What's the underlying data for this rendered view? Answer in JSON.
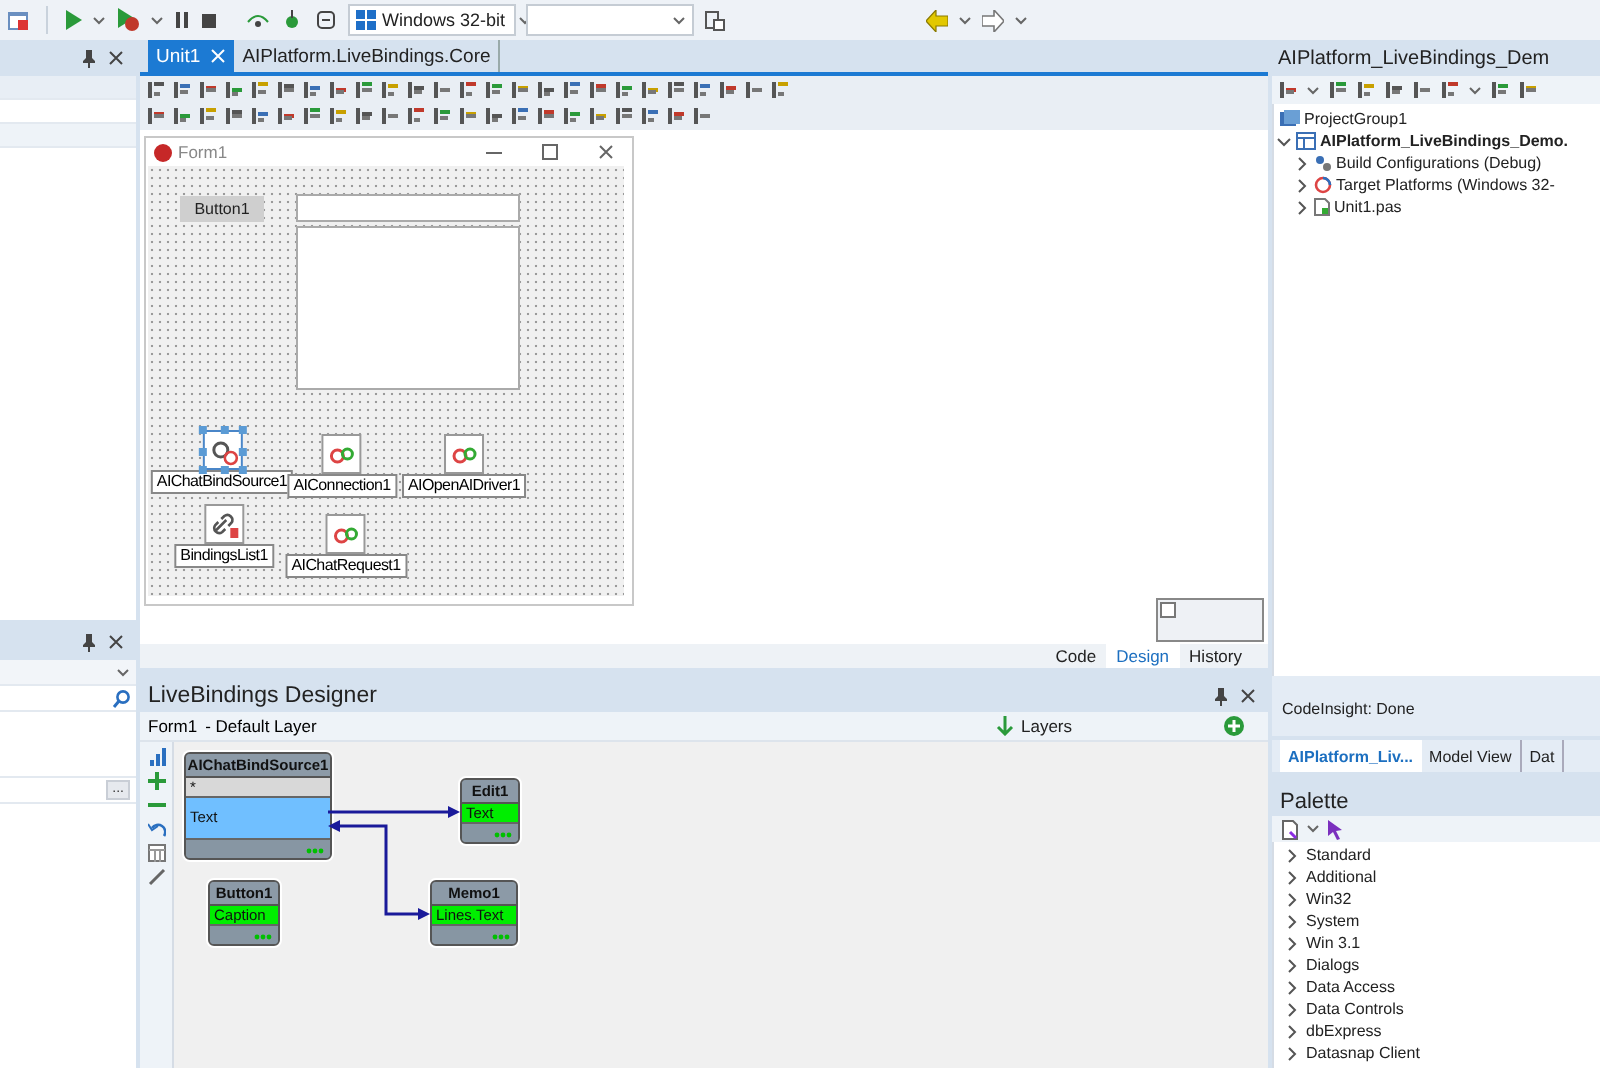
{
  "toolbar": {
    "platform": "Windows 32-bit"
  },
  "left_panels": {
    "browse_button": "..."
  },
  "editor": {
    "tabs": [
      {
        "label": "Unit1",
        "selected": true
      },
      {
        "label": "AIPlatform.LiveBindings.Core",
        "selected": false
      }
    ],
    "form": {
      "title": "Form1",
      "button": "Button1",
      "components": [
        {
          "name": "AIChatBindSource1",
          "kind": "bind_source",
          "selected": true
        },
        {
          "name": "AIConnection1",
          "kind": "connection",
          "selected": false
        },
        {
          "name": "AIOpenAIDriver1",
          "kind": "driver",
          "selected": false
        },
        {
          "name": "BindingsList1",
          "kind": "bindings_list",
          "selected": false
        },
        {
          "name": "AIChatRequest1",
          "kind": "request",
          "selected": false
        }
      ]
    },
    "view_tabs": [
      {
        "label": "Code",
        "selected": false
      },
      {
        "label": "Design",
        "selected": true
      },
      {
        "label": "History",
        "selected": false
      }
    ]
  },
  "livebindings": {
    "title": "LiveBindings Designer",
    "form": "Form1",
    "layer": "- Default Layer",
    "layers_button": "Layers",
    "nodes": [
      {
        "name": "AIChatBindSource1",
        "kind": "source",
        "members": [
          {
            "label": "*",
            "selected": false
          },
          {
            "label": "Text",
            "selected": true
          }
        ]
      },
      {
        "name": "Edit1",
        "kind": "control",
        "members": [
          {
            "label": "Text",
            "selected": false
          }
        ]
      },
      {
        "name": "Button1",
        "kind": "control",
        "members": [
          {
            "label": "Caption",
            "selected": false
          }
        ]
      },
      {
        "name": "Memo1",
        "kind": "control",
        "members": [
          {
            "label": "Lines.Text",
            "selected": false
          }
        ]
      }
    ]
  },
  "project": {
    "title": "AIPlatform_LiveBindings_Dem",
    "group": "ProjectGroup1",
    "items": [
      {
        "label": "AIPlatform_LiveBindings_Demo.",
        "expanded": true,
        "children": [
          {
            "label": "Build Configurations (Debug)",
            "kind": "config",
            "expanded": false
          },
          {
            "label": "Target Platforms (Windows 32-",
            "kind": "platforms",
            "expanded": false
          },
          {
            "label": "Unit1.pas",
            "kind": "file",
            "expanded": false
          }
        ]
      }
    ]
  },
  "status": "CodeInsight: Done",
  "bottom_tabs": [
    {
      "label": "AIPlatform_Liv...",
      "selected": true
    },
    {
      "label": "Model View",
      "selected": false
    },
    {
      "label": "Dat",
      "selected": false
    }
  ],
  "palette": {
    "title": "Palette",
    "categories": [
      {
        "label": "Standard",
        "expanded": false
      },
      {
        "label": "Additional",
        "expanded": false
      },
      {
        "label": "Win32",
        "expanded": false
      },
      {
        "label": "System",
        "expanded": false
      },
      {
        "label": "Win 3.1",
        "expanded": false
      },
      {
        "label": "Dialogs",
        "expanded": false
      },
      {
        "label": "Data Access",
        "expanded": false
      },
      {
        "label": "Data Controls",
        "expanded": false
      },
      {
        "label": "dbExpress",
        "expanded": false
      },
      {
        "label": "Datasnap Client",
        "expanded": false
      }
    ]
  }
}
